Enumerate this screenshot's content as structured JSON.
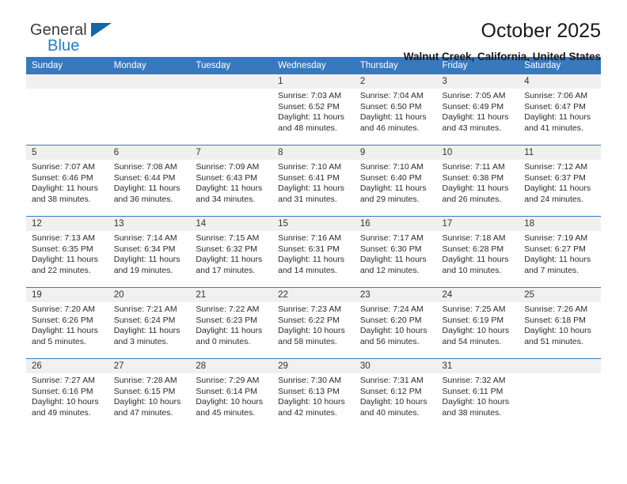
{
  "brand": {
    "name_top": "General",
    "name_bottom": "Blue",
    "accent_color": "#1f7fd0"
  },
  "header": {
    "title": "October 2025",
    "subtitle": "Walnut Creek, California, United States"
  },
  "calendar": {
    "header_color": "#3879bd",
    "weekday_headers": [
      "Sunday",
      "Monday",
      "Tuesday",
      "Wednesday",
      "Thursday",
      "Friday",
      "Saturday"
    ],
    "weeks": [
      [
        {
          "day": "",
          "empty": true,
          "sunrise": "",
          "sunset": "",
          "daylight_line1": "",
          "daylight_line2": ""
        },
        {
          "day": "",
          "empty": true,
          "sunrise": "",
          "sunset": "",
          "daylight_line1": "",
          "daylight_line2": ""
        },
        {
          "day": "",
          "empty": true,
          "sunrise": "",
          "sunset": "",
          "daylight_line1": "",
          "daylight_line2": ""
        },
        {
          "day": "1",
          "empty": false,
          "sunrise": "Sunrise: 7:03 AM",
          "sunset": "Sunset: 6:52 PM",
          "daylight_line1": "Daylight: 11 hours",
          "daylight_line2": "and 48 minutes."
        },
        {
          "day": "2",
          "empty": false,
          "sunrise": "Sunrise: 7:04 AM",
          "sunset": "Sunset: 6:50 PM",
          "daylight_line1": "Daylight: 11 hours",
          "daylight_line2": "and 46 minutes."
        },
        {
          "day": "3",
          "empty": false,
          "sunrise": "Sunrise: 7:05 AM",
          "sunset": "Sunset: 6:49 PM",
          "daylight_line1": "Daylight: 11 hours",
          "daylight_line2": "and 43 minutes."
        },
        {
          "day": "4",
          "empty": false,
          "sunrise": "Sunrise: 7:06 AM",
          "sunset": "Sunset: 6:47 PM",
          "daylight_line1": "Daylight: 11 hours",
          "daylight_line2": "and 41 minutes."
        }
      ],
      [
        {
          "day": "5",
          "empty": false,
          "sunrise": "Sunrise: 7:07 AM",
          "sunset": "Sunset: 6:46 PM",
          "daylight_line1": "Daylight: 11 hours",
          "daylight_line2": "and 38 minutes."
        },
        {
          "day": "6",
          "empty": false,
          "sunrise": "Sunrise: 7:08 AM",
          "sunset": "Sunset: 6:44 PM",
          "daylight_line1": "Daylight: 11 hours",
          "daylight_line2": "and 36 minutes."
        },
        {
          "day": "7",
          "empty": false,
          "sunrise": "Sunrise: 7:09 AM",
          "sunset": "Sunset: 6:43 PM",
          "daylight_line1": "Daylight: 11 hours",
          "daylight_line2": "and 34 minutes."
        },
        {
          "day": "8",
          "empty": false,
          "sunrise": "Sunrise: 7:10 AM",
          "sunset": "Sunset: 6:41 PM",
          "daylight_line1": "Daylight: 11 hours",
          "daylight_line2": "and 31 minutes."
        },
        {
          "day": "9",
          "empty": false,
          "sunrise": "Sunrise: 7:10 AM",
          "sunset": "Sunset: 6:40 PM",
          "daylight_line1": "Daylight: 11 hours",
          "daylight_line2": "and 29 minutes."
        },
        {
          "day": "10",
          "empty": false,
          "sunrise": "Sunrise: 7:11 AM",
          "sunset": "Sunset: 6:38 PM",
          "daylight_line1": "Daylight: 11 hours",
          "daylight_line2": "and 26 minutes."
        },
        {
          "day": "11",
          "empty": false,
          "sunrise": "Sunrise: 7:12 AM",
          "sunset": "Sunset: 6:37 PM",
          "daylight_line1": "Daylight: 11 hours",
          "daylight_line2": "and 24 minutes."
        }
      ],
      [
        {
          "day": "12",
          "empty": false,
          "sunrise": "Sunrise: 7:13 AM",
          "sunset": "Sunset: 6:35 PM",
          "daylight_line1": "Daylight: 11 hours",
          "daylight_line2": "and 22 minutes."
        },
        {
          "day": "13",
          "empty": false,
          "sunrise": "Sunrise: 7:14 AM",
          "sunset": "Sunset: 6:34 PM",
          "daylight_line1": "Daylight: 11 hours",
          "daylight_line2": "and 19 minutes."
        },
        {
          "day": "14",
          "empty": false,
          "sunrise": "Sunrise: 7:15 AM",
          "sunset": "Sunset: 6:32 PM",
          "daylight_line1": "Daylight: 11 hours",
          "daylight_line2": "and 17 minutes."
        },
        {
          "day": "15",
          "empty": false,
          "sunrise": "Sunrise: 7:16 AM",
          "sunset": "Sunset: 6:31 PM",
          "daylight_line1": "Daylight: 11 hours",
          "daylight_line2": "and 14 minutes."
        },
        {
          "day": "16",
          "empty": false,
          "sunrise": "Sunrise: 7:17 AM",
          "sunset": "Sunset: 6:30 PM",
          "daylight_line1": "Daylight: 11 hours",
          "daylight_line2": "and 12 minutes."
        },
        {
          "day": "17",
          "empty": false,
          "sunrise": "Sunrise: 7:18 AM",
          "sunset": "Sunset: 6:28 PM",
          "daylight_line1": "Daylight: 11 hours",
          "daylight_line2": "and 10 minutes."
        },
        {
          "day": "18",
          "empty": false,
          "sunrise": "Sunrise: 7:19 AM",
          "sunset": "Sunset: 6:27 PM",
          "daylight_line1": "Daylight: 11 hours",
          "daylight_line2": "and 7 minutes."
        }
      ],
      [
        {
          "day": "19",
          "empty": false,
          "sunrise": "Sunrise: 7:20 AM",
          "sunset": "Sunset: 6:26 PM",
          "daylight_line1": "Daylight: 11 hours",
          "daylight_line2": "and 5 minutes."
        },
        {
          "day": "20",
          "empty": false,
          "sunrise": "Sunrise: 7:21 AM",
          "sunset": "Sunset: 6:24 PM",
          "daylight_line1": "Daylight: 11 hours",
          "daylight_line2": "and 3 minutes."
        },
        {
          "day": "21",
          "empty": false,
          "sunrise": "Sunrise: 7:22 AM",
          "sunset": "Sunset: 6:23 PM",
          "daylight_line1": "Daylight: 11 hours",
          "daylight_line2": "and 0 minutes."
        },
        {
          "day": "22",
          "empty": false,
          "sunrise": "Sunrise: 7:23 AM",
          "sunset": "Sunset: 6:22 PM",
          "daylight_line1": "Daylight: 10 hours",
          "daylight_line2": "and 58 minutes."
        },
        {
          "day": "23",
          "empty": false,
          "sunrise": "Sunrise: 7:24 AM",
          "sunset": "Sunset: 6:20 PM",
          "daylight_line1": "Daylight: 10 hours",
          "daylight_line2": "and 56 minutes."
        },
        {
          "day": "24",
          "empty": false,
          "sunrise": "Sunrise: 7:25 AM",
          "sunset": "Sunset: 6:19 PM",
          "daylight_line1": "Daylight: 10 hours",
          "daylight_line2": "and 54 minutes."
        },
        {
          "day": "25",
          "empty": false,
          "sunrise": "Sunrise: 7:26 AM",
          "sunset": "Sunset: 6:18 PM",
          "daylight_line1": "Daylight: 10 hours",
          "daylight_line2": "and 51 minutes."
        }
      ],
      [
        {
          "day": "26",
          "empty": false,
          "sunrise": "Sunrise: 7:27 AM",
          "sunset": "Sunset: 6:16 PM",
          "daylight_line1": "Daylight: 10 hours",
          "daylight_line2": "and 49 minutes."
        },
        {
          "day": "27",
          "empty": false,
          "sunrise": "Sunrise: 7:28 AM",
          "sunset": "Sunset: 6:15 PM",
          "daylight_line1": "Daylight: 10 hours",
          "daylight_line2": "and 47 minutes."
        },
        {
          "day": "28",
          "empty": false,
          "sunrise": "Sunrise: 7:29 AM",
          "sunset": "Sunset: 6:14 PM",
          "daylight_line1": "Daylight: 10 hours",
          "daylight_line2": "and 45 minutes."
        },
        {
          "day": "29",
          "empty": false,
          "sunrise": "Sunrise: 7:30 AM",
          "sunset": "Sunset: 6:13 PM",
          "daylight_line1": "Daylight: 10 hours",
          "daylight_line2": "and 42 minutes."
        },
        {
          "day": "30",
          "empty": false,
          "sunrise": "Sunrise: 7:31 AM",
          "sunset": "Sunset: 6:12 PM",
          "daylight_line1": "Daylight: 10 hours",
          "daylight_line2": "and 40 minutes."
        },
        {
          "day": "31",
          "empty": false,
          "sunrise": "Sunrise: 7:32 AM",
          "sunset": "Sunset: 6:11 PM",
          "daylight_line1": "Daylight: 10 hours",
          "daylight_line2": "and 38 minutes."
        },
        {
          "day": "",
          "empty": true,
          "sunrise": "",
          "sunset": "",
          "daylight_line1": "",
          "daylight_line2": ""
        }
      ]
    ]
  }
}
